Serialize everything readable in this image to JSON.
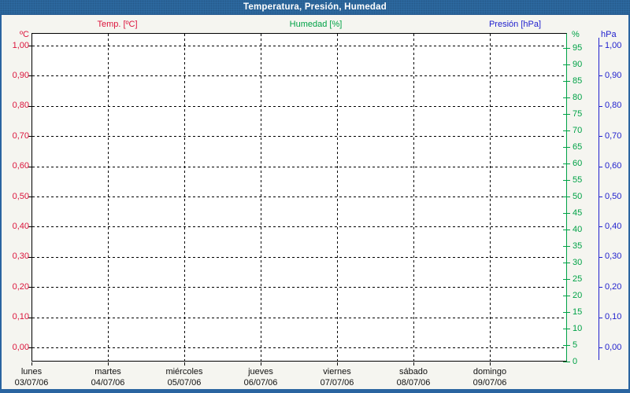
{
  "window": {
    "title": "Temperatura, Presión, Humedad"
  },
  "legend": {
    "temp_label": "Temp. [ºC]",
    "humidity_label": "Humedad [%]",
    "pressure_label": "Presión [hPa]"
  },
  "colors": {
    "temp": "#DC143C",
    "humidity": "#00A246",
    "pressure": "#2121CE",
    "titlebar_bg": "#2E6CA2",
    "window_border": "#2A64A0",
    "page_bg": "#F5F5F0",
    "plot_bg": "#FFFFFF",
    "grid": "#000000"
  },
  "axes": {
    "temp": {
      "unit": "ºC",
      "ticks": [
        "1,00",
        "0,90",
        "0,80",
        "0,70",
        "0,60",
        "0,50",
        "0,40",
        "0,30",
        "0,20",
        "0,10",
        "0,00"
      ]
    },
    "humidity": {
      "unit": "%",
      "ticks": [
        "95",
        "90",
        "85",
        "80",
        "75",
        "70",
        "65",
        "60",
        "55",
        "50",
        "45",
        "40",
        "35",
        "30",
        "25",
        "20",
        "15",
        "10",
        "5",
        "0"
      ]
    },
    "pressure": {
      "unit": "hPa",
      "ticks": [
        "1,00",
        "0,90",
        "0,80",
        "0,70",
        "0,60",
        "0,50",
        "0,40",
        "0,30",
        "0,20",
        "0,10",
        "0,00"
      ]
    }
  },
  "x_axis": {
    "days": [
      {
        "name": "lunes",
        "date": "03/07/06"
      },
      {
        "name": "martes",
        "date": "04/07/06"
      },
      {
        "name": "miércoles",
        "date": "05/07/06"
      },
      {
        "name": "jueves",
        "date": "06/07/06"
      },
      {
        "name": "viernes",
        "date": "07/07/06"
      },
      {
        "name": "sábado",
        "date": "08/07/06"
      },
      {
        "name": "domingo",
        "date": "09/07/06"
      }
    ]
  },
  "chart_data": {
    "type": "line",
    "title": "Temperatura, Presión, Humedad",
    "categories": [
      "lunes 03/07/06",
      "martes 04/07/06",
      "miércoles 05/07/06",
      "jueves 06/07/06",
      "viernes 07/07/06",
      "sábado 08/07/06",
      "domingo 09/07/06"
    ],
    "series": [
      {
        "name": "Temp. [ºC]",
        "y_axis": "ºC",
        "color": "#DC143C",
        "values": []
      },
      {
        "name": "Humedad [%]",
        "y_axis": "%",
        "color": "#00A246",
        "values": []
      },
      {
        "name": "Presión [hPa]",
        "y_axis": "hPa",
        "color": "#2121CE",
        "values": []
      }
    ],
    "y_axes": [
      {
        "label": "ºC",
        "side": "left",
        "min": 0.0,
        "max": 1.0,
        "step": 0.1,
        "tick_format": "comma-decimal"
      },
      {
        "label": "%",
        "side": "right",
        "min": 0,
        "max": 95,
        "step": 5
      },
      {
        "label": "hPa",
        "side": "right-outer",
        "min": 0.0,
        "max": 1.0,
        "step": 0.1,
        "tick_format": "comma-decimal"
      }
    ],
    "grid": "dashed",
    "plot_empty": true
  }
}
